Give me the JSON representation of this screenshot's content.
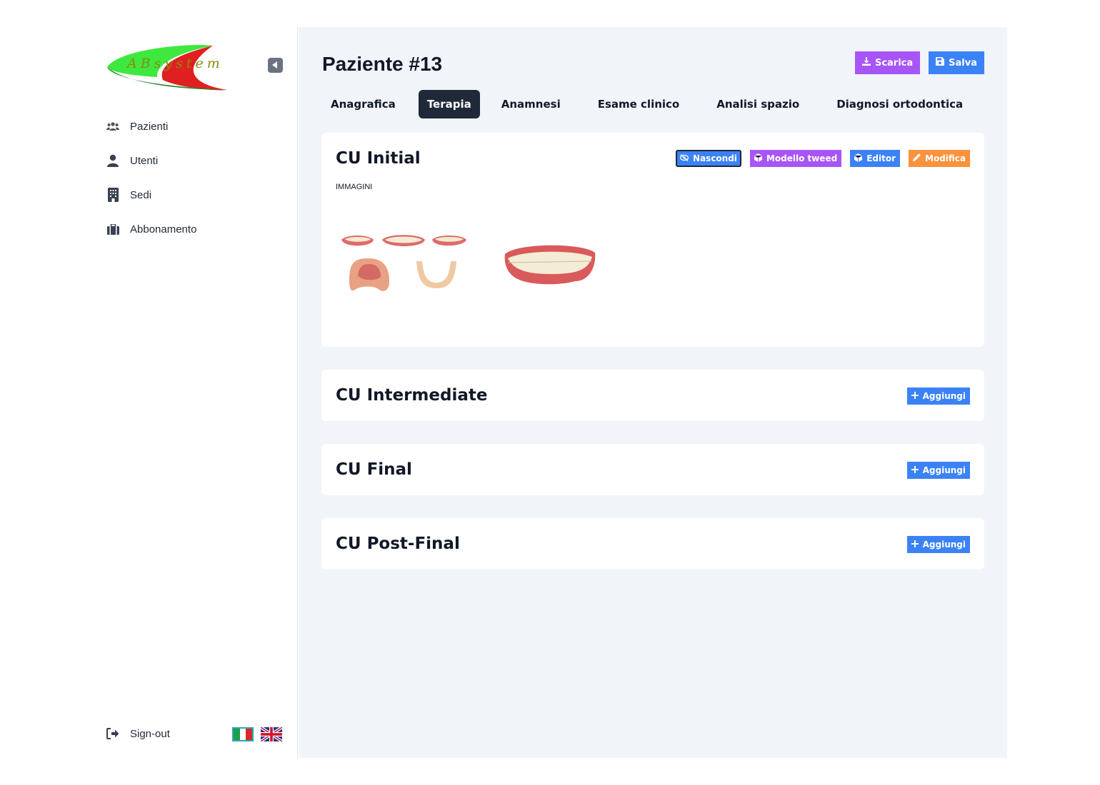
{
  "sidebar": {
    "logo_text": "ABsystem",
    "nav": [
      {
        "label": "Pazienti",
        "icon": "users-icon"
      },
      {
        "label": "Utenti",
        "icon": "user-icon"
      },
      {
        "label": "Sedi",
        "icon": "building-icon"
      },
      {
        "label": "Abbonamento",
        "icon": "briefcase-icon"
      }
    ],
    "signout_label": "Sign-out",
    "languages": [
      "it",
      "en"
    ]
  },
  "header": {
    "title": "Paziente #13",
    "download_label": "Scarica",
    "save_label": "Salva"
  },
  "tabs": [
    {
      "label": "Anagrafica",
      "active": false
    },
    {
      "label": "Terapia",
      "active": true
    },
    {
      "label": "Anamnesi",
      "active": false
    },
    {
      "label": "Esame clinico",
      "active": false
    },
    {
      "label": "Analisi spazio",
      "active": false
    },
    {
      "label": "Diagnosi ortodontica",
      "active": false
    }
  ],
  "sections": {
    "initial": {
      "title": "CU Initial",
      "hide_label": "Nascondi",
      "tweed_label": "Modello tweed",
      "editor_label": "Editor",
      "edit_label": "Modifica",
      "images_label": "IMMAGINI"
    },
    "intermediate": {
      "title": "CU Intermediate",
      "add_label": "Aggiungi"
    },
    "final": {
      "title": "CU Final",
      "add_label": "Aggiungi"
    },
    "post_final": {
      "title": "CU Post-Final",
      "add_label": "Aggiungi"
    }
  },
  "colors": {
    "purple": "#a855f7",
    "blue": "#3b82f6",
    "orange": "#fb923c",
    "tab_active": "#1f2937",
    "main_bg": "#f1f4f8"
  }
}
